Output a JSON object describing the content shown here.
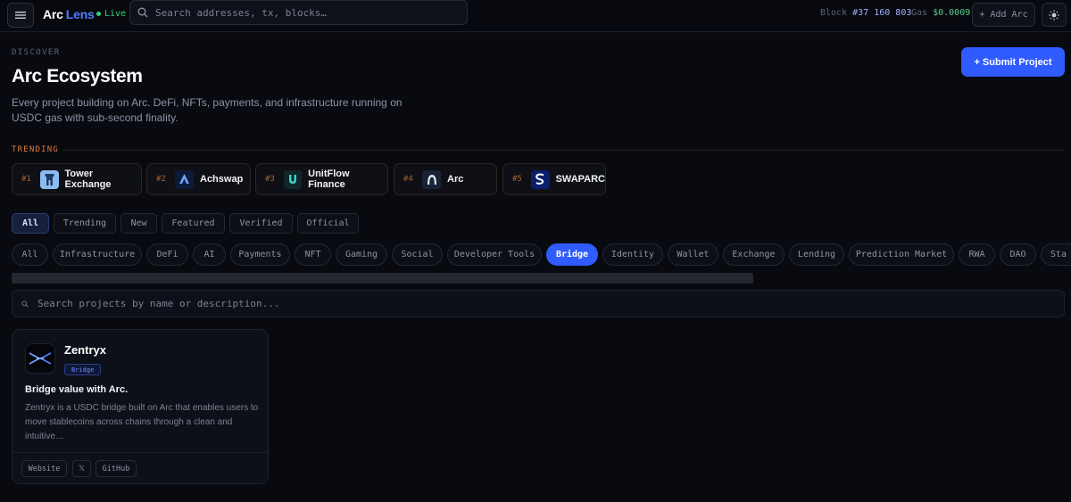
{
  "header": {
    "brand_part1": "Arc",
    "brand_part2": "Lens",
    "live_label": "Live",
    "search_placeholder": "Search addresses, tx, blocks…",
    "block_label": "Block",
    "block_value": "#37 160 803",
    "gas_label": "Gas",
    "gas_value": "$0.0009",
    "add_arc_label": "+ Add Arc"
  },
  "hero": {
    "eyebrow": "DISCOVER",
    "title": "Arc Ecosystem",
    "description": "Every project building on Arc. DeFi, NFTs, payments, and infrastructure running on USDC gas with sub-second finality.",
    "submit_label": "+ Submit Project"
  },
  "trending": {
    "label": "TRENDING",
    "items": [
      {
        "rank": "#1",
        "name": "Tower Exchange",
        "icon": "tower-icon"
      },
      {
        "rank": "#2",
        "name": "Achswap",
        "icon": "achswap-logo-icon"
      },
      {
        "rank": "#3",
        "name": "UnitFlow Finance",
        "icon": "unitflow-logo-icon"
      },
      {
        "rank": "#4",
        "name": "Arc",
        "icon": "arc-logo-icon"
      },
      {
        "rank": "#5",
        "name": "SWAPARC",
        "icon": "swaparc-logo-icon"
      }
    ]
  },
  "filters": {
    "tabs": [
      "All",
      "Trending",
      "New",
      "Featured",
      "Verified",
      "Official"
    ],
    "active": "All"
  },
  "categories": {
    "items": [
      "All",
      "Infrastructure",
      "DeFi",
      "AI",
      "Payments",
      "NFT",
      "Gaming",
      "Social",
      "Developer Tools",
      "Bridge",
      "Identity",
      "Wallet",
      "Exchange",
      "Lending",
      "Prediction Market",
      "RWA",
      "DAO",
      "Sta"
    ],
    "active": "Bridge"
  },
  "project_search": {
    "placeholder": "Search projects by name or description..."
  },
  "projects": [
    {
      "name": "Zentryx",
      "category": "Bridge",
      "tagline": "Bridge value with Arc.",
      "description": "Zentryx is a USDC bridge built on Arc that enables users to move stablecoins across chains through a clean and intuitive…",
      "links": [
        "Website",
        "𝕏",
        "GitHub"
      ]
    }
  ],
  "colors": {
    "accent": "#2f5bff",
    "live": "#33d17a",
    "trending": "#e07b3a",
    "background": "#080a10"
  }
}
